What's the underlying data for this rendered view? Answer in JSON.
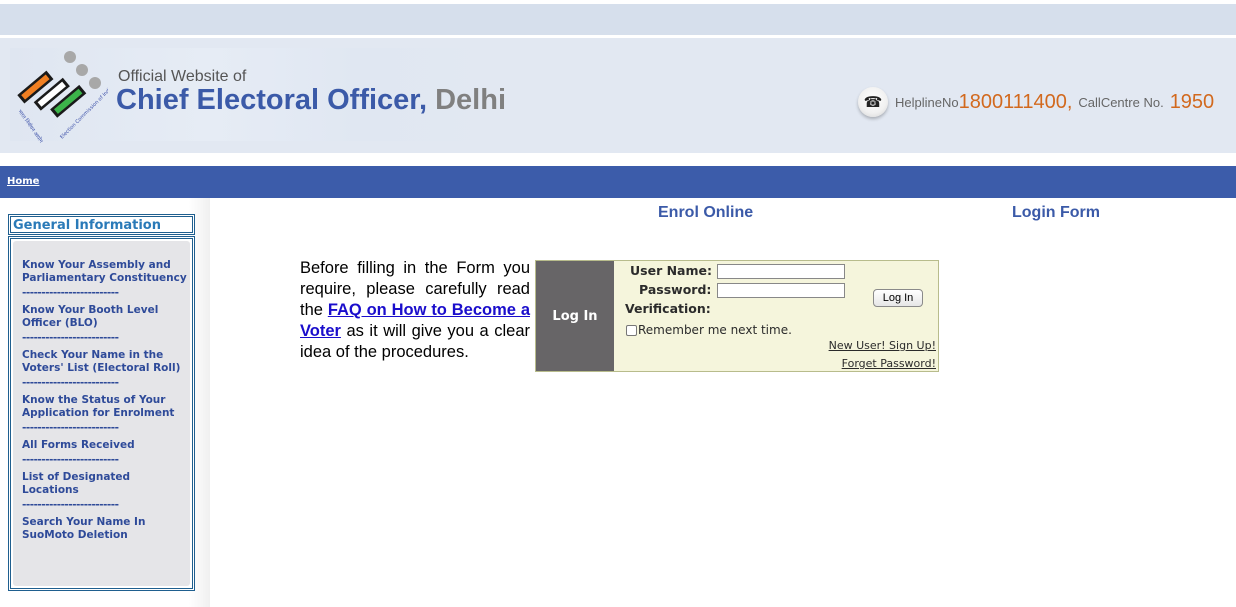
{
  "header": {
    "subtitle": "Official Website of",
    "title_main": "Chief Electoral Officer,",
    "title_city": " Delhi",
    "logo_icon": "election-commission-logo-icon",
    "helpline": {
      "icon": "telephone-icon",
      "helpline_label": "HelplineNo",
      "helpline_number": "1800111400,",
      "callcentre_label": "CallCentre No.",
      "callcentre_number": "1950",
      "number_color": "#d2691e"
    }
  },
  "nav": {
    "items": [
      {
        "label": "Home"
      }
    ],
    "color": "#3c5caa"
  },
  "sidebar": {
    "title": "General Information",
    "separator": "-------------------------",
    "items": [
      {
        "label": "Know Your Assembly and Parliamentary Constituency"
      },
      {
        "label": "Know Your Booth Level Officer (BLO)"
      },
      {
        "label": "Check Your Name in the Voters' List (Electoral Roll)"
      },
      {
        "label": "Know the Status of Your Application for Enrolment"
      },
      {
        "label": "All Forms Received"
      },
      {
        "label": "List of Designated Locations"
      },
      {
        "label": "Search Your Name In SuoMoto Deletion"
      }
    ]
  },
  "main": {
    "enrol_title": "Enrol Online",
    "login_title": "Login Form",
    "intro": {
      "before": "Before filling in the Form you require, please carefully read the ",
      "link": "FAQ on How to Become a Voter",
      "after": "  as it will give you a clear idea of the procedures."
    },
    "login_form": {
      "side_label": "Log In",
      "username_label": "User Name:",
      "username_value": "",
      "password_label": "Password:",
      "password_value": "",
      "verification_label": "Verification:",
      "remember_label": "Remember me next time.",
      "remember_checked": false,
      "submit_label": "Log In",
      "signup_link": "New User! Sign Up!",
      "forgot_link": "Forget Password!"
    }
  }
}
